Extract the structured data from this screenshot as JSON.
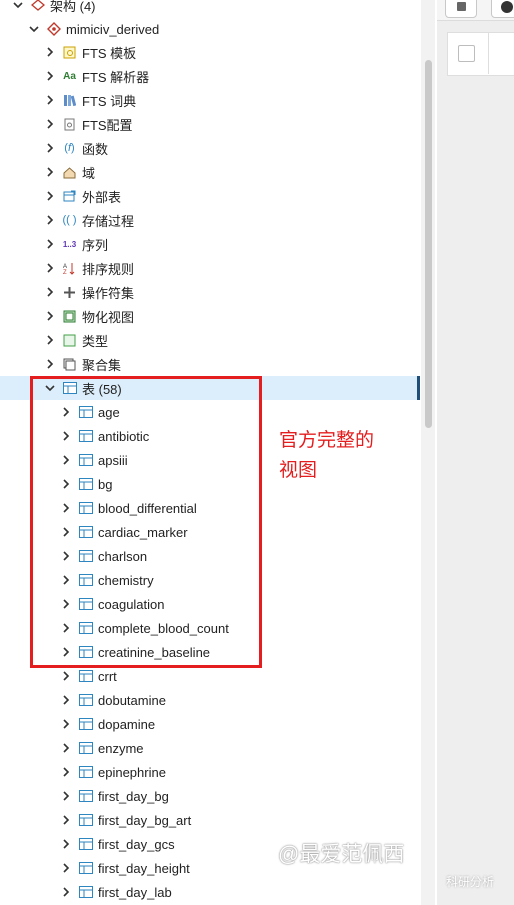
{
  "tree": {
    "schemas_label": "架构 (4)",
    "schema_name": "mimiciv_derived",
    "object_groups": [
      {
        "label": "FTS 模板",
        "icon": "fts-template-icon"
      },
      {
        "label": "FTS 解析器",
        "icon": "fts-parser-icon"
      },
      {
        "label": "FTS 词典",
        "icon": "fts-dictionary-icon"
      },
      {
        "label": "FTS配置",
        "icon": "fts-configuration-icon"
      },
      {
        "label": "函数",
        "icon": "function-icon"
      },
      {
        "label": "域",
        "icon": "domain-icon"
      },
      {
        "label": "外部表",
        "icon": "foreign-table-icon"
      },
      {
        "label": "存储过程",
        "icon": "procedure-icon"
      },
      {
        "label": "序列",
        "icon": "sequence-icon"
      },
      {
        "label": "排序规则",
        "icon": "collation-icon"
      },
      {
        "label": "操作符集",
        "icon": "operator-icon"
      },
      {
        "label": "物化视图",
        "icon": "materialized-view-icon"
      },
      {
        "label": "类型",
        "icon": "type-icon"
      },
      {
        "label": "聚合集",
        "icon": "aggregate-icon"
      }
    ],
    "tables_label": "表 (58)",
    "tables": [
      "age",
      "antibiotic",
      "apsiii",
      "bg",
      "blood_differential",
      "cardiac_marker",
      "charlson",
      "chemistry",
      "coagulation",
      "complete_blood_count",
      "creatinine_baseline",
      "crrt",
      "dobutamine",
      "dopamine",
      "enzyme",
      "epinephrine",
      "first_day_bg",
      "first_day_bg_art",
      "first_day_gcs",
      "first_day_height",
      "first_day_lab"
    ]
  },
  "annotation": {
    "line1": "官方完整的",
    "line2": "视图"
  },
  "watermark": {
    "main": "@最爱范佩西",
    "sub": "科研分析"
  },
  "colors": {
    "accent": "#1f4e79",
    "selected_bg": "#dceefb",
    "annotation": "#e41e1e",
    "table_icon": "#2e86c1"
  }
}
